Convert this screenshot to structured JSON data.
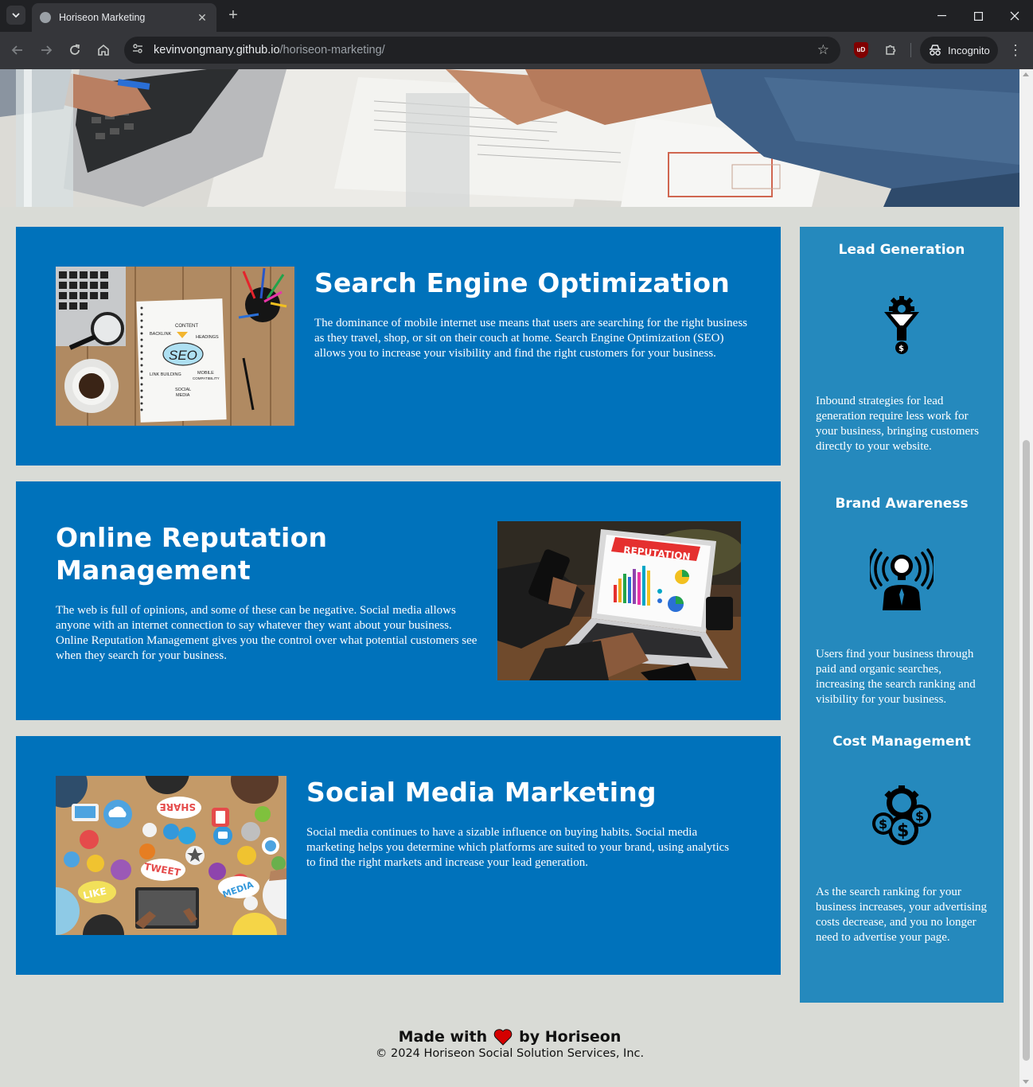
{
  "browser": {
    "tab_title": "Horiseon Marketing",
    "url_host": "kevinvongmany.github.io",
    "url_path": "/horiseon-marketing/",
    "incognito_label": "Incognito",
    "ublock_label": "uD"
  },
  "services": [
    {
      "title": "Search Engine Optimization",
      "body": "The dominance of mobile internet use means that users are searching for the right business as they travel, shop, or sit on their couch at home. Search Engine Optimization (SEO) allows you to increase your visibility and find the right customers for your business."
    },
    {
      "title": "Online Reputation Management",
      "body": "The web is full of opinions, and some of these can be negative. Social media allows anyone with an internet connection to say whatever they want about your business. Online Reputation Management gives you the control over what potential customers see when they search for your business."
    },
    {
      "title": "Social Media Marketing",
      "body": "Social media continues to have a sizable influence on buying habits. Social media marketing helps you determine which platforms are suited to your brand, using analytics to find the right markets and increase your lead generation."
    }
  ],
  "benefits": [
    {
      "title": "Lead Generation",
      "icon": "lead-generation-icon",
      "body": "Inbound strategies for lead generation require less work for your business, bringing customers directly to your website."
    },
    {
      "title": "Brand Awareness",
      "icon": "brand-awareness-icon",
      "body": "Users find your business through paid and organic searches, increasing the search ranking and visibility for your business."
    },
    {
      "title": "Cost Management",
      "icon": "cost-management-icon",
      "body": "As the search ranking for your business increases, your advertising costs decrease, and you no longer need to advertise your page."
    }
  ],
  "seo_image_text": {
    "content": "CONTENT",
    "backlink": "BACKLINK",
    "headings": "HEADINGS",
    "seo": "SEO",
    "link_building": "LINK BUILDING",
    "mobile": "MOBILE",
    "compat": "COMPATIBILITY",
    "social": "SOCIAL",
    "media": "MEDIA"
  },
  "reputation_image_text": {
    "banner": "REPUTATION"
  },
  "social_image_text": {
    "share": "SHARE",
    "tweet": "TWEET",
    "like": "LIKE",
    "media": "MEDIA"
  },
  "footer": {
    "made_with": "Made with",
    "by": "by Horiseon",
    "copyright": "© 2024 Horiseon Social Solution Services, Inc."
  },
  "colors": {
    "card_blue": "#0072bb",
    "benefits_blue": "#2589bd",
    "page_bg": "#d9dbd6",
    "heart": "#d50000"
  }
}
